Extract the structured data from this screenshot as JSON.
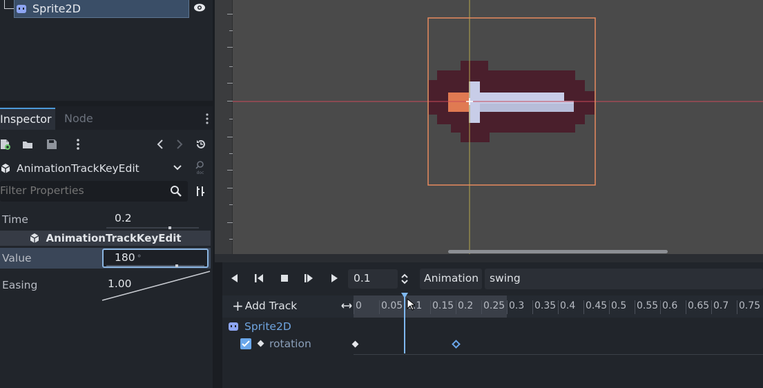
{
  "scene_tree": {
    "node_name": "Sprite2D"
  },
  "inspector": {
    "tabs": [
      "Inspector",
      "Node"
    ],
    "class_name": "AnimationTrackKeyEdit",
    "filter_placeholder": "Filter Properties",
    "section_title": "AnimationTrackKeyEdit",
    "properties": {
      "time": {
        "label": "Time",
        "value": "0.2"
      },
      "value": {
        "label": "Value",
        "value": "180",
        "unit": "°"
      },
      "easing": {
        "label": "Easing",
        "value": "1.00"
      }
    }
  },
  "animation": {
    "time_value": "0.1",
    "menu_label": "Animation",
    "current_animation": "swing",
    "add_track_label": "Add Track",
    "timeline_labels": [
      "0",
      "0.05",
      "0.1",
      "0.15",
      "0.2",
      "0.25",
      "0.3",
      "0.35",
      "0.4",
      "0.45",
      "0.5",
      "0.55",
      "0.6",
      "0.65",
      "0.7",
      "0.75"
    ],
    "track_node": "Sprite2D",
    "track_property": "rotation"
  },
  "colors": {
    "accent": "#4d9ad9",
    "selection": "#3a4e67",
    "sprite_outline": "#4a1f2c",
    "sprite_blade": "#c8cde8",
    "sprite_handle": "#e07a52"
  }
}
